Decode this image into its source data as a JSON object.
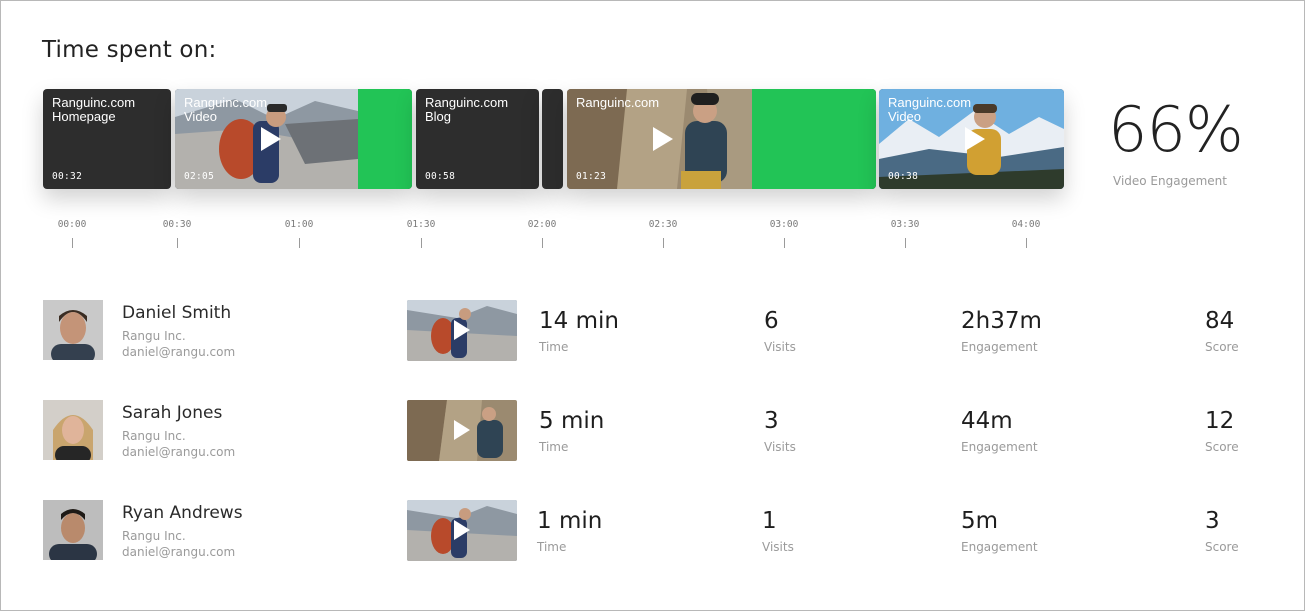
{
  "header": {
    "title": "Time spent on:"
  },
  "timeline": {
    "segments": [
      {
        "label": "Ranguinc.com\nHomepage",
        "time": "00:32",
        "type": "page"
      },
      {
        "label": "Ranguinc.com\nVideo",
        "time": "02:05",
        "type": "video",
        "thumbnail": "climber-glacier",
        "watched_fraction": 0.23
      },
      {
        "label": "Ranguinc.com\nBlog",
        "time": "00:58",
        "type": "page"
      },
      {
        "type": "page"
      },
      {
        "label": "Ranguinc.com",
        "time": "01:23",
        "type": "video",
        "thumbnail": "climber-rock-wall",
        "watched_fraction": 0.38
      },
      {
        "label": "Ranguinc.com\nVideo",
        "time": "00:38",
        "type": "video",
        "thumbnail": "hiker-mountains"
      }
    ],
    "ticks": [
      "00:00",
      "00:30",
      "01:00",
      "01:30",
      "02:00",
      "02:30",
      "03:00",
      "03:30",
      "04:00"
    ]
  },
  "engagement": {
    "value": "66%",
    "label": "Video Engagement"
  },
  "visitors": [
    {
      "name": "Daniel Smith",
      "company": "Rangu Inc.",
      "email": "daniel@rangu.com",
      "thumbnail": "climber-glacier",
      "time": "14 min",
      "time_label": "Time",
      "visits": "6",
      "visits_label": "Visits",
      "engagement": "2h37m",
      "engagement_label": "Engagement",
      "score": "84",
      "score_label": "Score"
    },
    {
      "name": "Sarah Jones",
      "company": "Rangu Inc.",
      "email": "daniel@rangu.com",
      "thumbnail": "climber-rock-wall",
      "time": "5 min",
      "time_label": "Time",
      "visits": "3",
      "visits_label": "Visits",
      "engagement": "44m",
      "engagement_label": "Engagement",
      "score": "12",
      "score_label": "Score"
    },
    {
      "name": "Ryan Andrews",
      "company": "Rangu Inc.",
      "email": "daniel@rangu.com",
      "thumbnail": "climber-glacier",
      "time": "1 min",
      "time_label": "Time",
      "visits": "1",
      "visits_label": "Visits",
      "engagement": "5m",
      "engagement_label": "Engagement",
      "score": "3",
      "score_label": "Score"
    }
  ],
  "colors": {
    "accent_green": "#22c456",
    "card_dark": "#2d2d2d",
    "muted_text": "#9a9a9a"
  }
}
